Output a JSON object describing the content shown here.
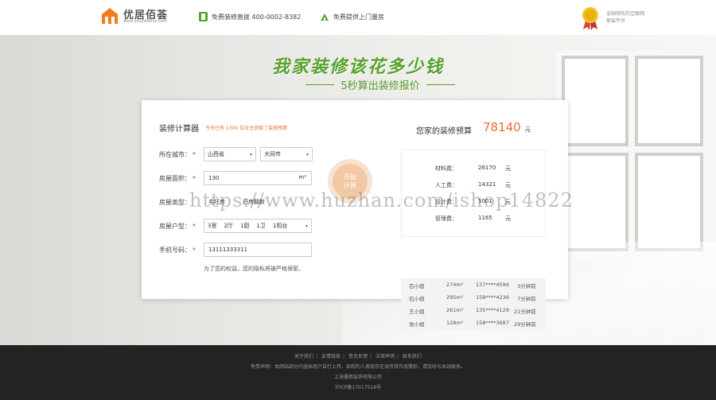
{
  "header": {
    "brand_name": "优居佰荟",
    "brand_url": "www.youjubaihui.com",
    "hotline": "免费装修直拨 400-0002-8382",
    "home_visit": "免费提供上门量房",
    "slogan": "全国领先的互联网家装平台"
  },
  "hero": {
    "title": "我家装修该花多少钱",
    "subtitle": "5秒算出装修报价"
  },
  "calculator": {
    "title": "装修计算器",
    "note": "今天已有 1300 位业主获取了装修预算",
    "city_label": "所在城市：",
    "province": "山西省",
    "city": "大同市",
    "area_label": "房屋面积：",
    "area_value": "130",
    "area_unit": "m²",
    "status_label": "房屋类型：",
    "status_value1": "毛坯房",
    "status_value2": "旧房翻新",
    "layout_label": "房屋户型：",
    "layout": [
      "3室",
      "2厅",
      "1厨",
      "1卫",
      "1阳台"
    ],
    "phone_label": "手机号码：",
    "phone_value": "13111333311",
    "privacy": "为了您的权益，您的隐私将被严格保密。",
    "button_line1": "开始",
    "button_line2": "计算"
  },
  "result": {
    "label": "您家的装修预算",
    "total": "78140",
    "unit": "元",
    "items": [
      {
        "name": "材料费：",
        "value": "26170",
        "unit": "元"
      },
      {
        "name": "人工费：",
        "value": "14321",
        "unit": "元"
      },
      {
        "name": "设计费：",
        "value": "5001",
        "unit": "元"
      },
      {
        "name": "管理费：",
        "value": "1165",
        "unit": "元"
      }
    ]
  },
  "recent": [
    {
      "name": "吕小姐",
      "area": "274m²",
      "phone": "137****4596",
      "time": "3分钟前"
    },
    {
      "name": "石小姐",
      "area": "295m²",
      "phone": "158****4236",
      "time": "7分钟前"
    },
    {
      "name": "王小姐",
      "area": "261m²",
      "phone": "135****4129",
      "time": "21分钟前"
    },
    {
      "name": "张小姐",
      "area": "128m²",
      "phone": "158****3687",
      "time": "29分钟前"
    }
  ],
  "footer": {
    "links": [
      "关于我们",
      "友情链接",
      "意见反馈",
      "法律声明",
      "联系我们"
    ],
    "disclaimer": "免责声明：本网站部分内容由用户自行上传，如权利人发现存在误传其作品情形，请及时与本站联系。",
    "company": "上海優偲装饰有限公司",
    "icp": "沪ICP备17017516号"
  },
  "watermark": "https://www.huzhan.com/ishop14822",
  "colors": {
    "accent_green": "#58a22e",
    "accent_orange": "#e8712e",
    "footer_bg": "#232323"
  }
}
